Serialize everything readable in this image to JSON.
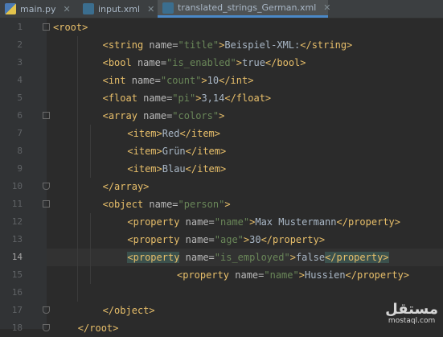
{
  "tabs": [
    {
      "label": "main.py",
      "icon": "python-file-icon",
      "active": false
    },
    {
      "label": "input.xml",
      "icon": "xml-file-icon",
      "active": false
    },
    {
      "label": "translated_strings_German.xml",
      "icon": "xml-file-icon",
      "active": true
    }
  ],
  "current_line": 14,
  "lines": [
    {
      "n": "1",
      "tokens": [
        [
          "tag",
          "<root>"
        ]
      ]
    },
    {
      "n": "2",
      "tokens": [
        [
          "tag",
          "<string "
        ],
        [
          "attr",
          "name="
        ],
        [
          "val",
          "\"title\""
        ],
        [
          "tag",
          ">"
        ],
        [
          "txt",
          "Beispiel-XML:"
        ],
        [
          "tag",
          "</string>"
        ]
      ]
    },
    {
      "n": "3",
      "tokens": [
        [
          "tag",
          "<bool "
        ],
        [
          "attr",
          "name="
        ],
        [
          "val",
          "\"is_enabled\""
        ],
        [
          "tag",
          ">"
        ],
        [
          "txt",
          "true"
        ],
        [
          "tag",
          "</bool>"
        ]
      ]
    },
    {
      "n": "4",
      "tokens": [
        [
          "tag",
          "<int "
        ],
        [
          "attr",
          "name="
        ],
        [
          "val",
          "\"count\""
        ],
        [
          "tag",
          ">"
        ],
        [
          "txt",
          "10"
        ],
        [
          "tag",
          "</int>"
        ]
      ]
    },
    {
      "n": "5",
      "tokens": [
        [
          "tag",
          "<float "
        ],
        [
          "attr",
          "name="
        ],
        [
          "val",
          "\"pi\""
        ],
        [
          "tag",
          ">"
        ],
        [
          "txt",
          "3,14"
        ],
        [
          "tag",
          "</float>"
        ]
      ]
    },
    {
      "n": "6",
      "tokens": [
        [
          "tag",
          "<array "
        ],
        [
          "attr",
          "name="
        ],
        [
          "val",
          "\"colors\""
        ],
        [
          "tag",
          ">"
        ]
      ]
    },
    {
      "n": "7",
      "tokens": [
        [
          "tag",
          "<item>"
        ],
        [
          "txt",
          "Red"
        ],
        [
          "tag",
          "</item>"
        ]
      ]
    },
    {
      "n": "8",
      "tokens": [
        [
          "tag",
          "<item>"
        ],
        [
          "txt",
          "Grün"
        ],
        [
          "tag",
          "</item>"
        ]
      ]
    },
    {
      "n": "9",
      "tokens": [
        [
          "tag",
          "<item>"
        ],
        [
          "txt",
          "Blau"
        ],
        [
          "tag",
          "</item>"
        ]
      ]
    },
    {
      "n": "10",
      "tokens": [
        [
          "tag",
          "</array>"
        ]
      ]
    },
    {
      "n": "11",
      "tokens": [
        [
          "tag",
          "<object "
        ],
        [
          "attr",
          "name="
        ],
        [
          "val",
          "\"person\""
        ],
        [
          "tag",
          ">"
        ]
      ]
    },
    {
      "n": "12",
      "tokens": [
        [
          "tag",
          "<property "
        ],
        [
          "attr",
          "name="
        ],
        [
          "val",
          "\"name\""
        ],
        [
          "tag",
          ">"
        ],
        [
          "txt",
          "Max Mustermann"
        ],
        [
          "tag",
          "</property>"
        ]
      ]
    },
    {
      "n": "13",
      "tokens": [
        [
          "tag",
          "<property "
        ],
        [
          "attr",
          "name="
        ],
        [
          "val",
          "\"age\""
        ],
        [
          "tag",
          ">"
        ],
        [
          "txt",
          "30"
        ],
        [
          "tag",
          "</property>"
        ]
      ]
    },
    {
      "n": "14",
      "tokens": [
        [
          "tag",
          "<property"
        ],
        [
          "attr",
          " name="
        ],
        [
          "val",
          "\"is_employed\""
        ],
        [
          "tag",
          ">"
        ],
        [
          "txt",
          "false"
        ],
        [
          "tag",
          "</property>"
        ]
      ]
    },
    {
      "n": "15",
      "tokens": [
        [
          "tag",
          "<property "
        ],
        [
          "attr",
          "name="
        ],
        [
          "val",
          "\"name\""
        ],
        [
          "tag",
          ">"
        ],
        [
          "txt",
          "Hussien"
        ],
        [
          "tag",
          "</property>"
        ]
      ]
    },
    {
      "n": "16",
      "tokens": []
    },
    {
      "n": "17",
      "tokens": [
        [
          "tag",
          "</object>"
        ]
      ]
    },
    {
      "n": "18",
      "tokens": [
        [
          "tag",
          "</root>"
        ]
      ]
    }
  ],
  "watermark": {
    "arabic": "مستقل",
    "latin": "mostaql.com"
  },
  "colors": {
    "tag": "#e8bf6a",
    "attr": "#bababa",
    "value": "#6a8759",
    "text": "#a9b7c6",
    "background": "#2b2b2b"
  }
}
